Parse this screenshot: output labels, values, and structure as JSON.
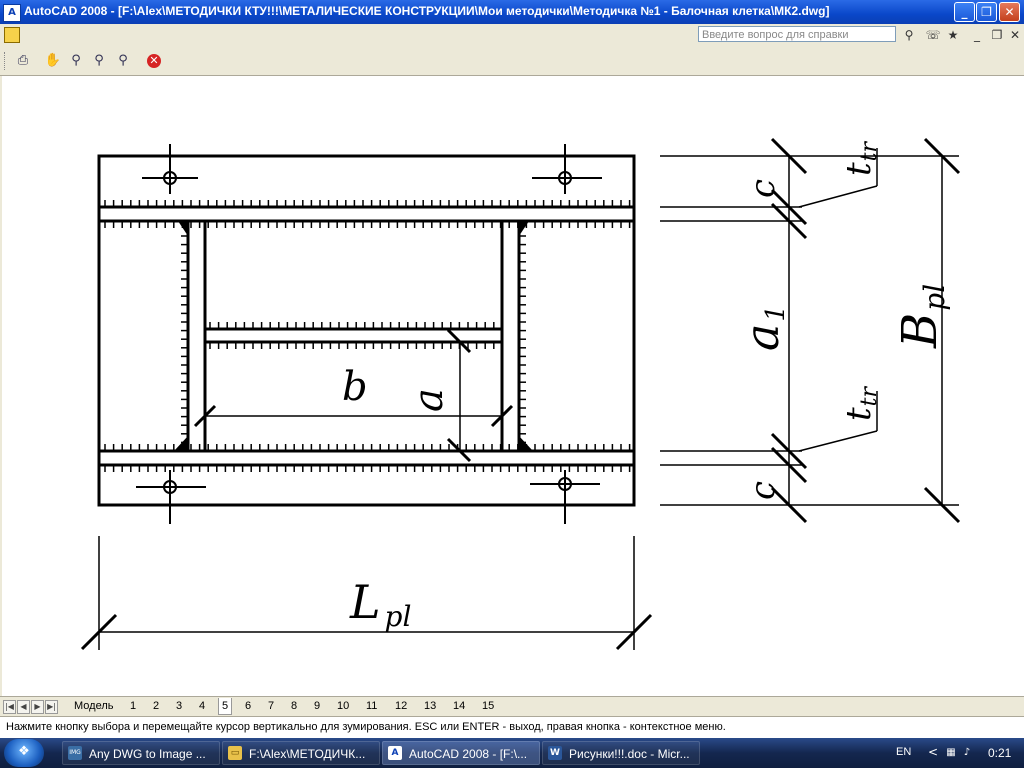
{
  "window": {
    "title": "AutoCAD 2008 - [F:\\Alex\\МЕТОДИЧКИ КТУ!!!\\МЕТАЛИЧЕСКИЕ КОНСТРУКЦИИ\\Мои методички\\Методичка №1 - Балочная клетка\\МК2.dwg]",
    "app_icon": "A",
    "minimize_glyph": "_",
    "restore_glyph": "❐",
    "close_glyph": "✕"
  },
  "menubar": {
    "help_placeholder": "Введите вопрос для справки",
    "search_glyph": "⚲",
    "mdi_min": "_",
    "mdi_restore": "❐",
    "mdi_close": "✕"
  },
  "toolbar": {
    "icons": [
      "plot-icon",
      "pan-icon",
      "zoom-realtime-icon",
      "zoom-window-icon",
      "zoom-previous-icon",
      "close-preview-icon"
    ],
    "stop_glyph": "✕"
  },
  "drawing": {
    "labels": {
      "b": "b",
      "a": "a",
      "a1_main": "a",
      "a1_sub": "1",
      "B_main": "B",
      "B_sub": "pl",
      "L_main": "L",
      "L_sub": "pl",
      "c_top": "c",
      "c_bottom": "c",
      "ttr_top_main": "t",
      "ttr_top_sub": "tr",
      "ttr_bottom_main": "t",
      "ttr_bottom_sub": "tr"
    }
  },
  "layout_tabs": {
    "nav": [
      "|◀",
      "◀",
      "▶",
      "▶|"
    ],
    "tabs": [
      "Модель",
      "1",
      "2",
      "3",
      "4",
      "5",
      "6",
      "7",
      "8",
      "9",
      "10",
      "11",
      "12",
      "13",
      "14",
      "15"
    ],
    "active": "5"
  },
  "command_line": {
    "text": "Нажмите кнопку выбора и перемещайте курсор вертикально для зумирования. ESC или ENTER - выход, правая кнопка - контекстное меню."
  },
  "taskbar": {
    "start_glyph": "❖",
    "items": [
      {
        "label": "Any DWG to Image ...",
        "icon": "IMG",
        "active": false
      },
      {
        "label": "F:\\Alex\\МЕТОДИЧК...",
        "icon": "▭",
        "active": false
      },
      {
        "label": "AutoCAD 2008 - [F:\\...",
        "icon": "A",
        "active": true
      },
      {
        "label": "Рисунки!!!.doc - Micr...",
        "icon": "W",
        "active": false
      }
    ],
    "language": "EN",
    "tray_chevron": "<",
    "clock": "0:21"
  },
  "colors": {
    "titlebar": "#0a47c9",
    "chrome": "#ece9d8",
    "canvas": "#ffffff",
    "taskbar": "#14274f",
    "stroke": "#000000"
  }
}
